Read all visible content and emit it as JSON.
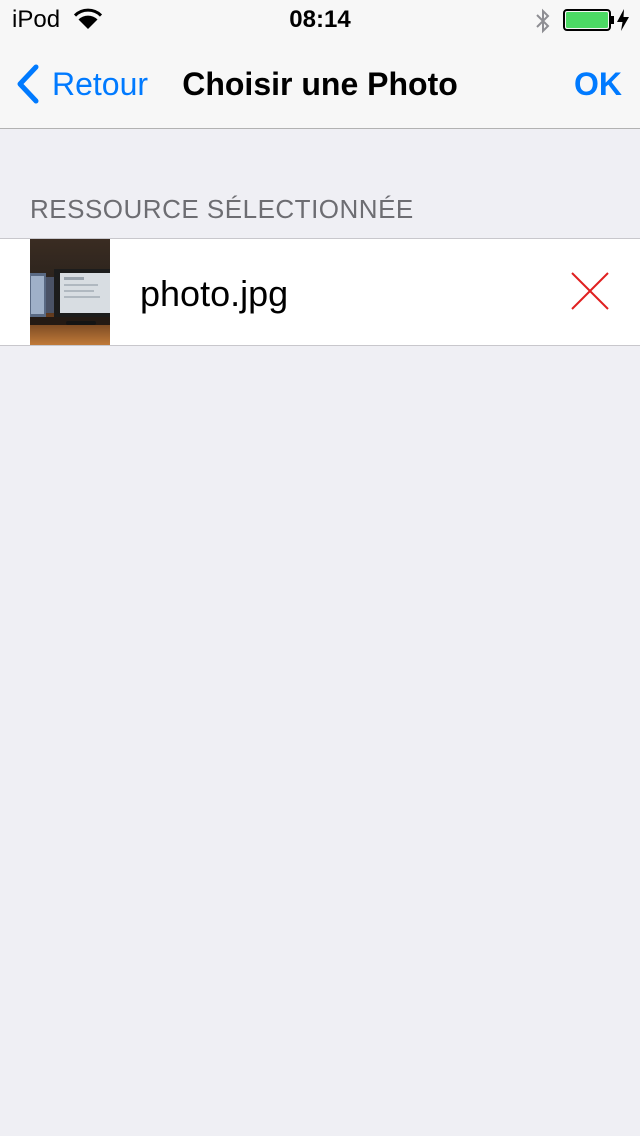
{
  "status_bar": {
    "carrier": "iPod",
    "time": "08:14",
    "battery_level": 1.0,
    "charging": true
  },
  "nav": {
    "back_label": "Retour",
    "title": "Choisir une Photo",
    "ok_label": "OK"
  },
  "section": {
    "header": "RESSOURCE SÉLECTIONNÉE",
    "items": [
      {
        "file_name": "photo.jpg"
      }
    ]
  },
  "colors": {
    "tint": "#007aff",
    "remove": "#e02020",
    "battery": "#4cd964",
    "background": "#efeff4"
  },
  "icons": {
    "back": "chevron-left-icon",
    "remove": "close-icon",
    "wifi": "wifi-icon",
    "bluetooth": "bluetooth-icon",
    "battery": "battery-icon",
    "charging": "lightning-icon"
  }
}
